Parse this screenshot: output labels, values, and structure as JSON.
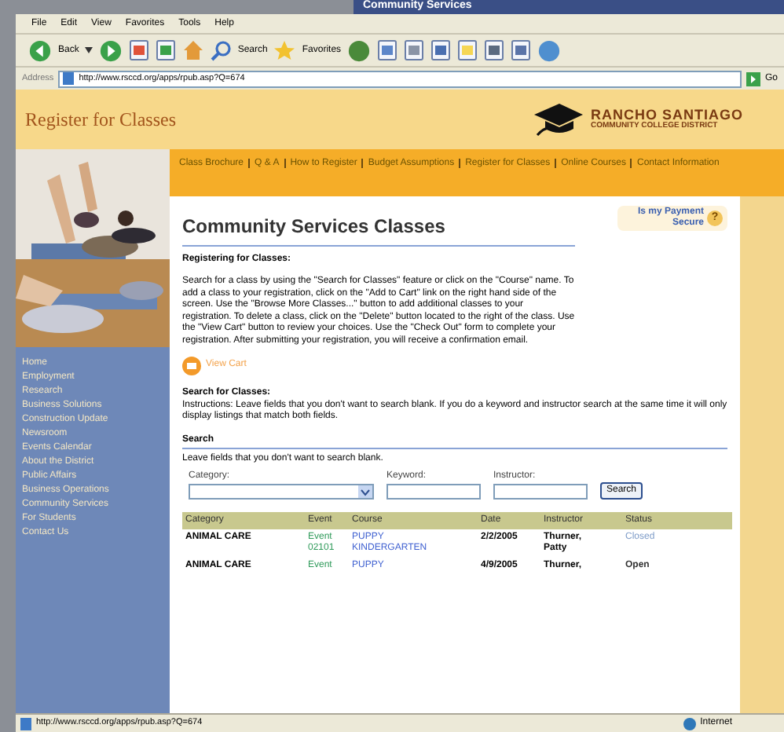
{
  "background_window": {
    "title": "Community Services"
  },
  "menu_bar": [
    "File",
    "Edit",
    "View",
    "Favorites",
    "Tools",
    "Help"
  ],
  "toolbar": {
    "back": "Back",
    "search": "Search",
    "favorites": "Favorites"
  },
  "address_bar": {
    "label": "Address",
    "value": "http://www.rsccd.org/apps/rpub.asp?Q=674",
    "go": "Go"
  },
  "header": {
    "title": "Register for Classes",
    "logo_name": "RANCHO SANTIAGO",
    "logo_sub": "COMMUNITY COLLEGE DISTRICT"
  },
  "top_links": [
    "Class Brochure",
    "Q & A",
    "How to Register",
    "Budget Assumptions",
    "Register for Classes",
    "Online Courses",
    "Contact Information"
  ],
  "sidebar": {
    "items": [
      "Home",
      "Employment",
      "Research",
      "Business Solutions",
      "Construction Update",
      "Newsroom",
      "Events Calendar",
      "About the District",
      "Public Affairs",
      "Business Operations",
      "Community Services",
      "For Students",
      "Contact Us"
    ]
  },
  "content": {
    "title": "Community Services Classes",
    "secure_link": "Is my Payment Secure",
    "secure_icon": "?",
    "registering_heading": "Registering for Classes:",
    "registering_text": "Search for a class by using the \"Search for Classes\" feature or click on the \"Course\" name.  To add a class to your registration, click on the \"Add to Cart\" link on the right hand side of the screen.  Use the \"Browse More Classes...\" button to add additional classes to your registration.  To delete a class, click on the \"Delete\" button located to the right of the class.  Use the \"View Cart\" button to review your choices.  Use the \"Check Out\" form to complete your registration.  After submitting your registration, you will receive a confirmation email.",
    "view_cart": "View Cart",
    "search_heading": "Search for Classes:",
    "search_text": "Instructions: Leave fields that you don't want to search blank. If you do a keyword and instructor search at the same time it will only display listings that match both fields.",
    "search_box_heading": "Search",
    "search_box_text": "Leave fields that you don't want to search blank.",
    "fields": [
      {
        "kind": "select",
        "label": "Category:"
      },
      {
        "kind": "text",
        "label": "Keyword:"
      },
      {
        "kind": "text",
        "label": "Instructor:"
      }
    ],
    "search_button": "Search"
  },
  "table": {
    "columns": [
      "Category",
      "Event",
      "Course",
      "Date",
      "Instructor",
      "Status"
    ],
    "rows": [
      {
        "category": "ANIMAL CARE",
        "event": "Event 02101",
        "course": "PUPPY KINDERGARTEN",
        "date": "2/2/2005",
        "instructor": "Thurner, Patty",
        "status": "Closed",
        "open": false
      },
      {
        "category": "ANIMAL CARE",
        "event": "Event",
        "course": "PUPPY",
        "date": "4/9/2005",
        "instructor": "Thurner,",
        "status": "Open",
        "open": true
      }
    ]
  },
  "status_bar": {
    "url": "http://www.rsccd.org/apps/rpub.asp?Q=674",
    "zone": "Internet"
  }
}
